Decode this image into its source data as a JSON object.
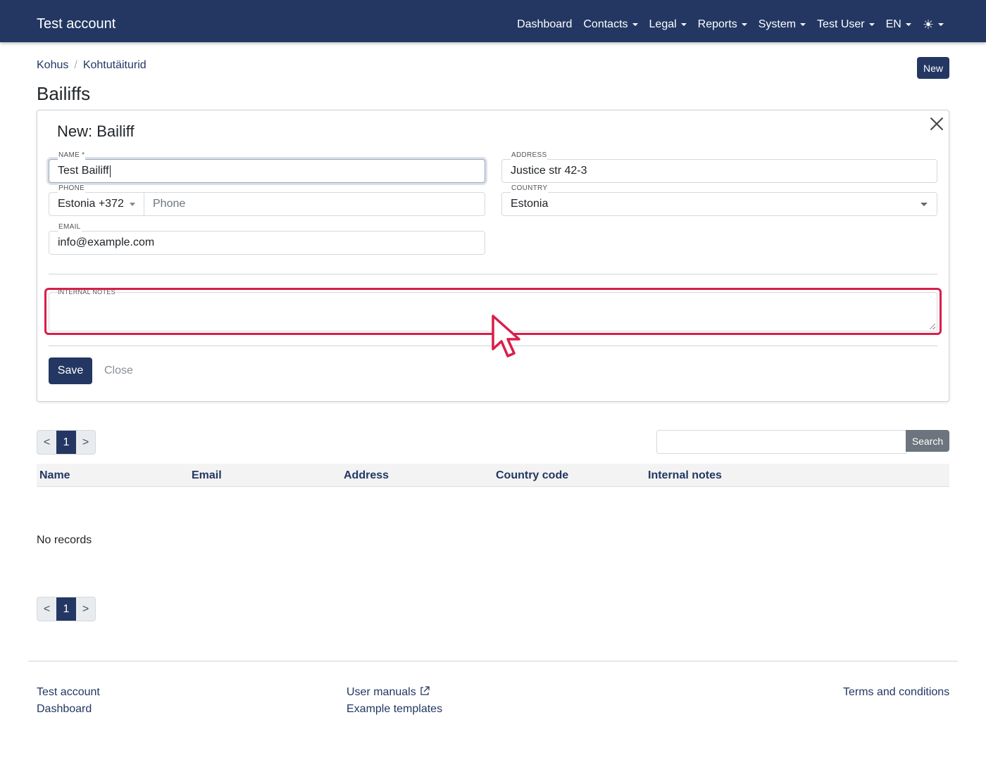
{
  "app": {
    "brand": "Test account"
  },
  "nav": {
    "items": [
      {
        "label": "Dashboard",
        "dropdown": false
      },
      {
        "label": "Contacts",
        "dropdown": true
      },
      {
        "label": "Legal",
        "dropdown": true
      },
      {
        "label": "Reports",
        "dropdown": true
      },
      {
        "label": "System",
        "dropdown": true
      },
      {
        "label": "Test User",
        "dropdown": true
      },
      {
        "label": "EN",
        "dropdown": true
      }
    ],
    "theme_icon": "☀"
  },
  "breadcrumb": {
    "root": "Kohus",
    "separator": "/",
    "current": "Kohtutäiturid"
  },
  "page": {
    "title": "Bailiffs",
    "new_label": "New"
  },
  "form": {
    "title": "New: Bailiff",
    "name": {
      "label": "NAME *",
      "value": "Test Bailiff"
    },
    "address": {
      "label": "ADDRESS",
      "value": "Justice str 42-3"
    },
    "phone": {
      "label": "PHONE",
      "country": "Estonia +372",
      "placeholder": "Phone"
    },
    "country": {
      "label": "COUNTRY",
      "value": "Estonia"
    },
    "email": {
      "label": "EMAIL",
      "value": "info@example.com"
    },
    "notes": {
      "label": "INTERNAL NOTES",
      "value": ""
    },
    "save_label": "Save",
    "close_label": "Close"
  },
  "pager": {
    "prev": "<",
    "current": "1",
    "next": ">"
  },
  "search": {
    "button_label": "Search",
    "value": ""
  },
  "table": {
    "columns": [
      "Name",
      "Email",
      "Address",
      "Country code",
      "Internal notes"
    ],
    "empty_text": "No records"
  },
  "footer": {
    "col1": [
      "Test account",
      "Dashboard"
    ],
    "col2": [
      "User manuals",
      "Example templates"
    ],
    "col3": [
      "Terms and conditions"
    ]
  },
  "colors": {
    "primary": "#233762",
    "highlight": "#d81f4a",
    "secondary": "#6c757d"
  }
}
